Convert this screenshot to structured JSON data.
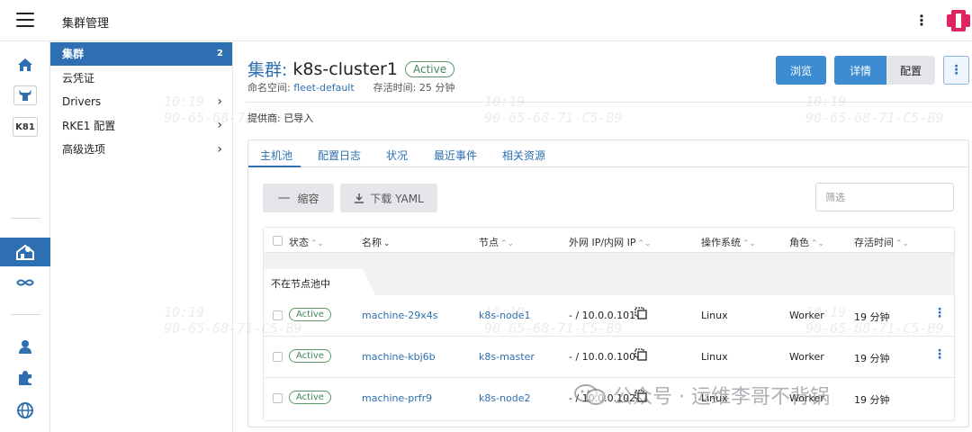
{
  "header": {
    "title": "集群管理"
  },
  "sidebar": {
    "items": [
      {
        "label": "集群",
        "count": "2"
      },
      {
        "label": "云凭证"
      },
      {
        "label": "Drivers"
      },
      {
        "label": "RKE1 配置"
      },
      {
        "label": "高级选项"
      }
    ],
    "rail_badge": "K81"
  },
  "cluster": {
    "title_prefix": "集群:",
    "name": "k8s-cluster1",
    "status": "Active",
    "namespace_label": "命名空间:",
    "namespace": "fleet-default",
    "uptime_label": "存活时间:",
    "uptime": "25 分钟",
    "provider_label": "提供商:",
    "provider": "已导入"
  },
  "actions": {
    "browse": "浏览",
    "details": "详情",
    "config": "配置"
  },
  "tabs": [
    {
      "label": "主机池"
    },
    {
      "label": "配置日志"
    },
    {
      "label": "状况"
    },
    {
      "label": "最近事件"
    },
    {
      "label": "相关资源"
    }
  ],
  "toolbar": {
    "scale_down": "缩容",
    "download_yaml": "下载 YAML",
    "filter_placeholder": "筛选"
  },
  "table": {
    "headers": {
      "state": "状态",
      "name": "名称",
      "node": "节点",
      "ip": "外网 IP/内网 IP",
      "os": "操作系统",
      "role": "角色",
      "age": "存活时间"
    },
    "group": "不在节点池中",
    "rows": [
      {
        "state": "Active",
        "name": "machine-29x4s",
        "node": "k8s-node1",
        "ip": "- / 10.0.0.101",
        "os": "Linux",
        "role": "Worker",
        "age": "19 分钟"
      },
      {
        "state": "Active",
        "name": "machine-kbj6b",
        "node": "k8s-master",
        "ip": "- / 10.0.0.100",
        "os": "Linux",
        "role": "Worker",
        "age": "19 分钟"
      },
      {
        "state": "Active",
        "name": "machine-prfr9",
        "node": "k8s-node2",
        "ip": "- / 10.0.0.102",
        "os": "Linux",
        "role": "Worker",
        "age": "19 分钟"
      }
    ]
  },
  "watermark": {
    "time": "10:19",
    "mac": "90-65-68-71-C5-B9"
  },
  "footer_watermark": "公众号 · 运维李哥不背锅"
}
